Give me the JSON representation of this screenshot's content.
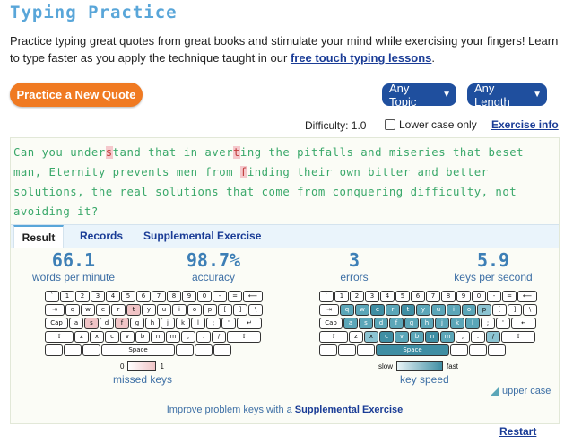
{
  "title": "Typing Practice",
  "intro": {
    "text": "Practice typing great quotes from great books and stimulate your mind while exercising your fingers! Learn to type faster as you apply the technique taught in our ",
    "link": "free touch typing lessons",
    "end": "."
  },
  "controls": {
    "new_quote": "Practice a New Quote",
    "topic": "Any Topic",
    "length": "Any Length",
    "difficulty": "Difficulty: 1.0",
    "lower_case": "Lower case only",
    "exercise_info": "Exercise info"
  },
  "quote": {
    "segments": [
      {
        "t": "Can you under",
        "s": "n"
      },
      {
        "t": "s",
        "s": "e"
      },
      {
        "t": "tand that in aver",
        "s": "n"
      },
      {
        "t": "t",
        "s": "e"
      },
      {
        "t": "ing the pitfalls and miseries that beset man, Eternity prevents men from ",
        "s": "n"
      },
      {
        "t": "f",
        "s": "e"
      },
      {
        "t": "inding their own bitter and better solutions, the real solutions that come from conquering difficulty, not avoiding it?",
        "s": "n"
      }
    ]
  },
  "tabs": [
    "Result",
    "Records",
    "Supplemental Exercise"
  ],
  "stats": {
    "wpm": {
      "value": "66.1",
      "label": "words per minute"
    },
    "accuracy": {
      "value": "98.7%",
      "label": "accuracy"
    },
    "errors": {
      "value": "3",
      "label": "errors"
    },
    "kps": {
      "value": "5.9",
      "label": "keys per second"
    }
  },
  "keyboard_rows": [
    [
      "`",
      "1",
      "2",
      "3",
      "4",
      "5",
      "6",
      "7",
      "8",
      "9",
      "0",
      "-",
      "=",
      "⟵"
    ],
    [
      "⇥",
      "q",
      "w",
      "e",
      "r",
      "t",
      "y",
      "u",
      "i",
      "o",
      "p",
      "[",
      "]",
      "\\"
    ],
    [
      "Cap",
      "a",
      "s",
      "d",
      "f",
      "g",
      "h",
      "j",
      "k",
      "l",
      ";",
      "'",
      "↵"
    ],
    [
      "⇧",
      "z",
      "x",
      "c",
      "v",
      "b",
      "n",
      "m",
      ",",
      ".",
      "/",
      "⇧"
    ],
    [
      "",
      "",
      "",
      "Space",
      "",
      "",
      ""
    ]
  ],
  "missed_keys": [
    "s",
    "f",
    "t"
  ],
  "slow_keys": {
    "strong": [
      "e",
      "t",
      "space",
      "n",
      "c"
    ],
    "medium": [
      "q",
      "w",
      "r",
      "y",
      "u",
      "i",
      "o",
      "a",
      "s",
      "d",
      "f",
      "g",
      "h",
      "j",
      "k",
      "v",
      "b",
      "m",
      "l"
    ],
    "light": [
      "p",
      "x",
      "/"
    ]
  },
  "legends": {
    "missed_min": "0",
    "missed_max": "1",
    "missed_label": "missed keys",
    "speed_slow": "slow",
    "speed_fast": "fast",
    "speed_label": "key speed",
    "upper_case": "upper case"
  },
  "improve": {
    "text": "Improve problem keys with a ",
    "link": "Supplemental Exercise"
  },
  "restart": "Restart",
  "colors": {
    "accent": "#59a6d9",
    "orange": "#f07a22",
    "navy": "#1f4f9e",
    "quote_green": "#3aa86a",
    "miss": "#f0c4c6",
    "speed": "#3f8ea3"
  }
}
